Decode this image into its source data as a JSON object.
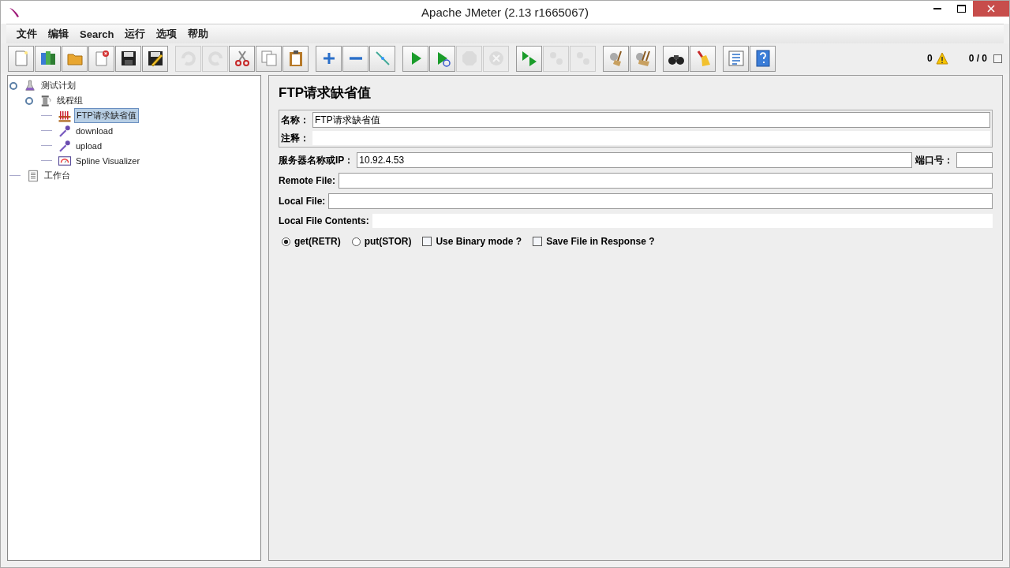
{
  "window": {
    "title": "Apache JMeter (2.13 r1665067)"
  },
  "menu": [
    "文件",
    "编辑",
    "Search",
    "运行",
    "选项",
    "帮助"
  ],
  "toolbar": [
    {
      "items": [
        {
          "kind": "new",
          "disabled": false
        },
        {
          "kind": "templates",
          "disabled": false
        },
        {
          "kind": "open",
          "disabled": false
        },
        {
          "kind": "close",
          "disabled": false
        },
        {
          "kind": "save",
          "disabled": false
        },
        {
          "kind": "saveas",
          "disabled": false
        }
      ]
    },
    {
      "items": [
        {
          "kind": "undo",
          "disabled": true
        },
        {
          "kind": "redo",
          "disabled": true
        },
        {
          "kind": "cut",
          "disabled": false
        },
        {
          "kind": "copy",
          "disabled": false
        },
        {
          "kind": "paste",
          "disabled": false
        }
      ]
    },
    {
      "items": [
        {
          "kind": "expand",
          "disabled": false
        },
        {
          "kind": "collapse",
          "disabled": false
        },
        {
          "kind": "toggle",
          "disabled": false
        }
      ]
    },
    {
      "items": [
        {
          "kind": "start",
          "disabled": false
        },
        {
          "kind": "startnp",
          "disabled": false
        },
        {
          "kind": "stop",
          "disabled": true
        },
        {
          "kind": "shutdown",
          "disabled": true
        }
      ]
    },
    {
      "items": [
        {
          "kind": "remotestart",
          "disabled": false
        },
        {
          "kind": "remotestop",
          "disabled": true
        },
        {
          "kind": "remoteshutdown",
          "disabled": true
        }
      ]
    },
    {
      "items": [
        {
          "kind": "clear",
          "disabled": false
        },
        {
          "kind": "clearall",
          "disabled": false
        }
      ]
    },
    {
      "items": [
        {
          "kind": "search",
          "disabled": false
        },
        {
          "kind": "reset",
          "disabled": false
        }
      ]
    },
    {
      "items": [
        {
          "kind": "functions",
          "disabled": false
        },
        {
          "kind": "help",
          "disabled": false
        }
      ]
    }
  ],
  "status": {
    "errors": "0",
    "threads": "0 / 0"
  },
  "tree": [
    {
      "label": "测试计划",
      "kind": "flask",
      "selected": false,
      "children": [
        {
          "label": "线程组",
          "kind": "spool",
          "selected": false,
          "children": [
            {
              "label": "FTP请求缺省值",
              "kind": "rack",
              "selected": true
            },
            {
              "label": "download",
              "kind": "dropper",
              "selected": false
            },
            {
              "label": "upload",
              "kind": "dropper",
              "selected": false
            },
            {
              "label": "Spline Visualizer",
              "kind": "gauge",
              "selected": false
            }
          ]
        }
      ]
    },
    {
      "label": "工作台",
      "kind": "notepad",
      "selected": false
    }
  ],
  "form": {
    "title": "FTP请求缺省值",
    "name": {
      "label": "名称：",
      "value": "FTP请求缺省值"
    },
    "comment": {
      "label": "注释："
    },
    "server": {
      "label": "服务器名称或IP：",
      "value": "10.92.4.53"
    },
    "port": {
      "label": "端口号："
    },
    "remote_file": {
      "label": "Remote File:"
    },
    "local_file": {
      "label": "Local File:"
    },
    "local_contents": {
      "label": "Local File Contents:"
    },
    "options": [
      {
        "kind": "radio",
        "label": "get(RETR)",
        "selected": true
      },
      {
        "kind": "radio",
        "label": "put(STOR)",
        "selected": false
      },
      {
        "kind": "checkbox",
        "label": "Use Binary mode ?",
        "checked": false
      },
      {
        "kind": "checkbox",
        "label": "Save File in Response ?",
        "checked": false
      }
    ]
  }
}
